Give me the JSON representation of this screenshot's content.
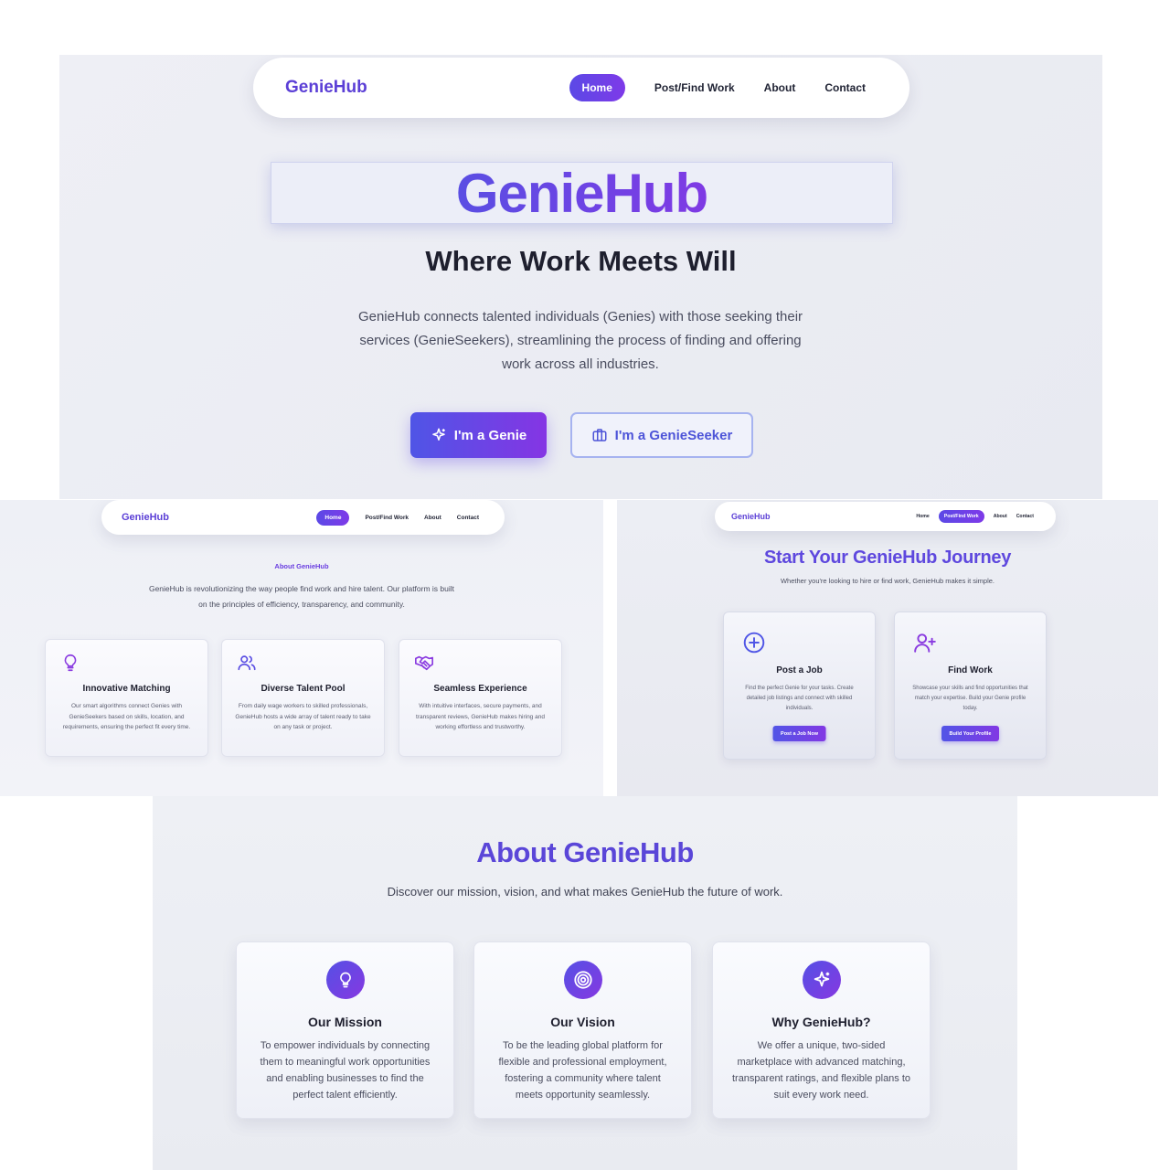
{
  "hero_panel": {
    "nav": {
      "logo": "GenieHub",
      "links": [
        "Home",
        "Post/Find Work",
        "About",
        "Contact"
      ],
      "active": "Home"
    },
    "title": "GenieHub",
    "tagline": "Where Work Meets Will",
    "description": "GenieHub connects talented individuals (Genies) with those seeking their services (GenieSeekers), streamlining the process of finding and offering work across all industries.",
    "buttons": {
      "genie": {
        "label": "I'm a Genie",
        "icon": "sparkles-icon"
      },
      "seeker": {
        "label": "I'm a GenieSeeker",
        "icon": "briefcase-icon"
      }
    }
  },
  "about_panel": {
    "nav": {
      "logo": "GenieHub",
      "links": [
        "Home",
        "Post/Find Work",
        "About",
        "Contact"
      ],
      "active": "Home"
    },
    "subtitle": "About GenieHub",
    "description": "GenieHub is revolutionizing the way people find work and hire talent. Our platform is built on the principles of efficiency, transparency, and community.",
    "features": [
      {
        "icon": "lightbulb-icon",
        "title": "Innovative Matching",
        "text": "Our smart algorithms connect Genies with GenieSeekers based on skills, location, and requirements, ensuring the perfect fit every time."
      },
      {
        "icon": "users-icon",
        "title": "Diverse Talent Pool",
        "text": "From daily wage workers to skilled professionals, GenieHub hosts a wide array of talent ready to take on any task or project."
      },
      {
        "icon": "handshake-icon",
        "title": "Seamless Experience",
        "text": "With intuitive interfaces, secure payments, and transparent reviews, GenieHub makes hiring and working effortless and trustworthy."
      }
    ]
  },
  "journey_panel": {
    "nav": {
      "logo": "GenieHub",
      "links": [
        "Home",
        "Post/Find Work",
        "About",
        "Contact"
      ],
      "active": "Post/Find Work"
    },
    "title": "Start Your GenieHub Journey",
    "subtitle": "Whether you're looking to hire or find work, GenieHub makes it simple.",
    "cards": [
      {
        "icon": "plus-circle-icon",
        "title": "Post a Job",
        "text": "Find the perfect Genie for your tasks. Create detailed job listings and connect with skilled individuals.",
        "button": "Post a Job Now"
      },
      {
        "icon": "user-plus-icon",
        "title": "Find Work",
        "text": "Showcase your skills and find opportunities that match your expertise. Build your Genie profile today.",
        "button": "Build Your Profile"
      }
    ]
  },
  "mission_panel": {
    "title": "About GenieHub",
    "subtitle": "Discover our mission, vision, and what makes GenieHub the future of work.",
    "cards": [
      {
        "icon": "lightbulb-icon",
        "title": "Our Mission",
        "text": "To empower individuals by connecting them to meaningful work opportunities and enabling businesses to find the perfect talent efficiently."
      },
      {
        "icon": "target-icon",
        "title": "Our Vision",
        "text": "To be the leading global platform for flexible and professional employment, fostering a community where talent meets opportunity seamlessly."
      },
      {
        "icon": "sparkles-icon",
        "title": "Why GenieHub?",
        "text": "We offer a unique, two-sided marketplace with advanced matching, transparent ratings, and flexible plans to suit every work need."
      }
    ]
  },
  "colors": {
    "brand": "#5b3fd6",
    "gradient_start": "#5a4ee3",
    "gradient_end": "#7f3ae4",
    "background": "#eceef4"
  }
}
